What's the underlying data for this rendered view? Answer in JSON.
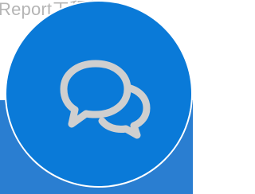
{
  "background": {
    "text": "Report工程师",
    "text_color": "#b5b5b5",
    "band_color": "#2a7ed1"
  },
  "fab": {
    "icon": "chat-bubbles-icon",
    "background_color": "#0a7ad8",
    "border_color": "#ffffff",
    "icon_color": "#cfcfcf"
  }
}
